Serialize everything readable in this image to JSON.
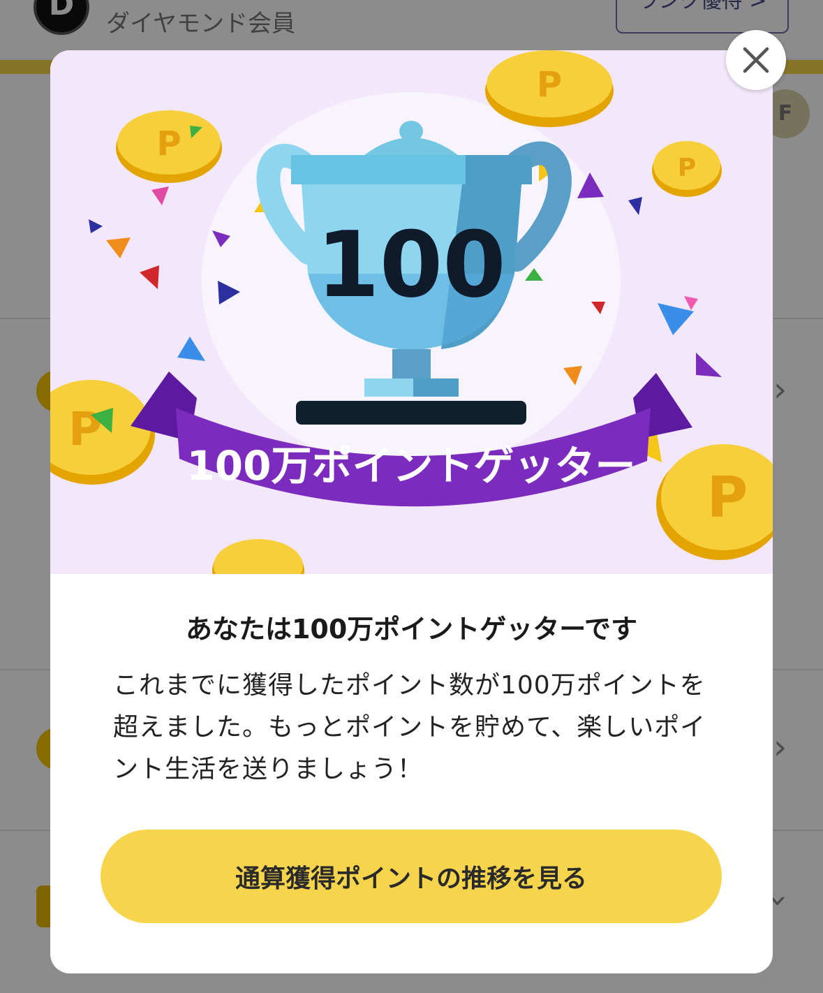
{
  "background": {
    "rank_logo_letter": "D",
    "rank_name": "ダイヤモンド会員",
    "rank_benefit_label": "ランク優待 >",
    "toggle_text": "F",
    "chevron": "›"
  },
  "modal": {
    "trophy_number": "100",
    "banner_text": "100万ポイントゲッター",
    "coin_letter": "P",
    "title": "あなたは100万ポイントゲッターです",
    "body": "これまでに獲得したポイント数が100万ポイントを超えました。もっとポイントを貯めて、楽しいポイント生活を送りましょう！",
    "cta_label": "通算獲得ポイントの推移を見る",
    "close_icon": "close-icon"
  },
  "colors": {
    "cta": "#f6d54c",
    "banner": "#7b2bbd",
    "hero_bg": "#f2e7fb",
    "coin": "#f5c518"
  }
}
